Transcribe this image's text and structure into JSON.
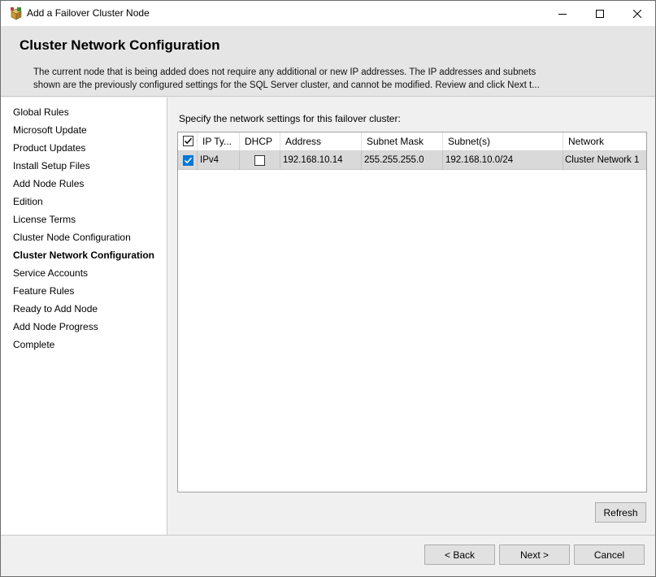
{
  "window": {
    "title": "Add a Failover Cluster Node",
    "icon": "setup-box-icon"
  },
  "header": {
    "title": "Cluster Network Configuration",
    "description_line1": "The current node that is being added does not require any additional or new IP addresses.  The IP addresses and subnets",
    "description_line2": "shown are the previously configured settings for the SQL Server cluster, and cannot be modified. Review and click Next t..."
  },
  "sidebar": {
    "items": [
      {
        "label": "Global Rules"
      },
      {
        "label": "Microsoft Update"
      },
      {
        "label": "Product Updates"
      },
      {
        "label": "Install Setup Files"
      },
      {
        "label": "Add Node Rules"
      },
      {
        "label": "Edition"
      },
      {
        "label": "License Terms"
      },
      {
        "label": "Cluster Node Configuration"
      },
      {
        "label": "Cluster Network Configuration",
        "active": true
      },
      {
        "label": "Service Accounts"
      },
      {
        "label": "Feature Rules"
      },
      {
        "label": "Ready to Add Node"
      },
      {
        "label": "Add Node Progress"
      },
      {
        "label": "Complete"
      }
    ]
  },
  "main": {
    "instruction": "Specify the network settings for this failover cluster:",
    "columns": [
      "IP Ty...",
      "DHCP",
      "Address",
      "Subnet Mask",
      "Subnet(s)",
      "Network"
    ],
    "rows": [
      {
        "selected": true,
        "ip_type": "IPv4",
        "dhcp": false,
        "address": "192.168.10.14",
        "subnet_mask": "255.255.255.0",
        "subnets": "192.168.10.0/24",
        "network": "Cluster Network 1"
      }
    ],
    "refresh_label": "Refresh"
  },
  "footer": {
    "back_label": "< Back",
    "next_label": "Next >",
    "cancel_label": "Cancel"
  },
  "colors": {
    "accent": "#0078d7",
    "header_bg": "#e5e5e5",
    "row_selected": "#d9d9d9"
  }
}
